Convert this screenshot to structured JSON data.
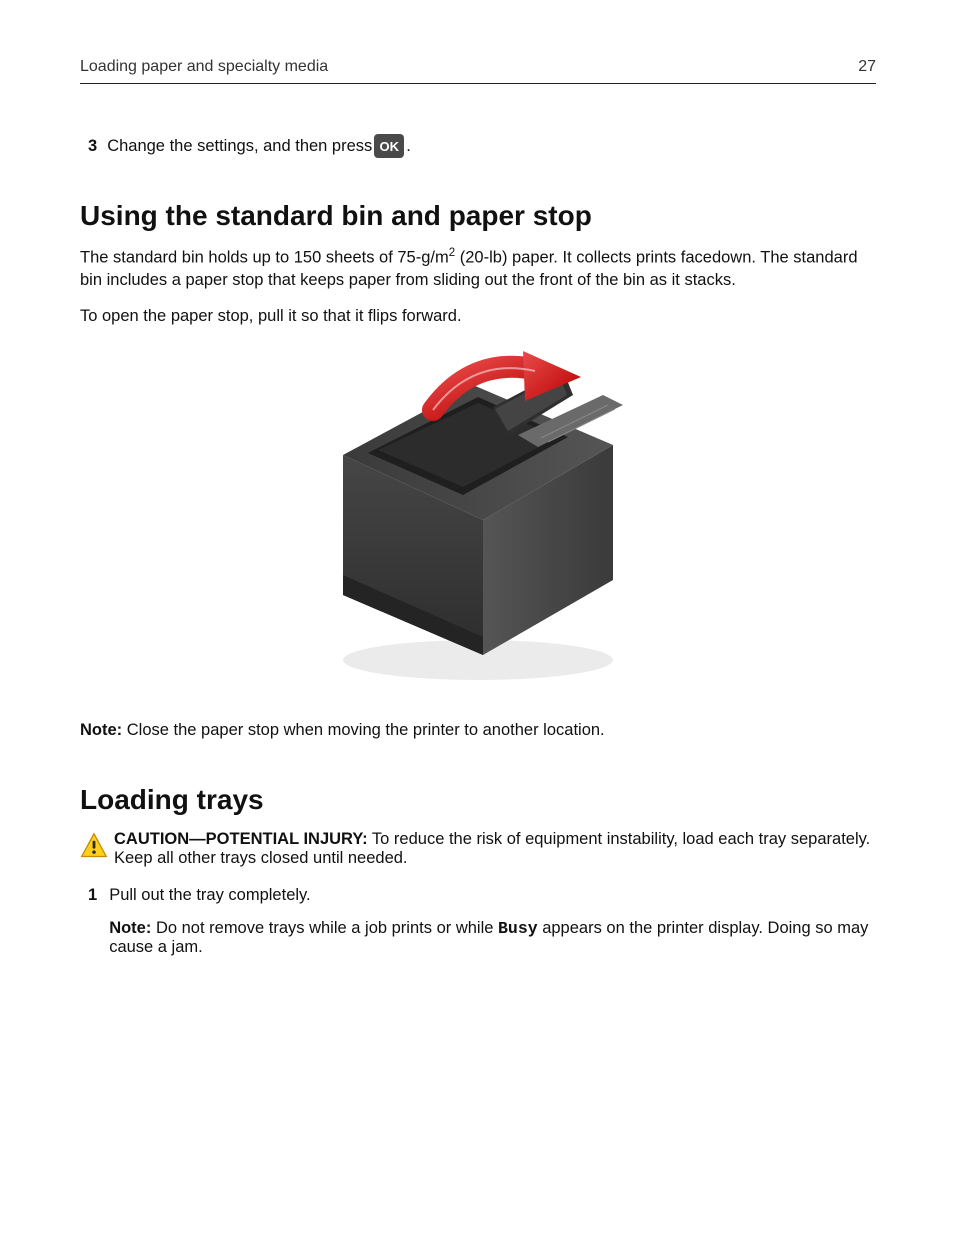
{
  "header": {
    "title": "Loading paper and specialty media",
    "page_no": "27"
  },
  "step3": {
    "num": "3",
    "before": "Change the settings, and then press ",
    "ok": "OK",
    "after": "."
  },
  "section1": {
    "heading": "Using the standard bin and paper stop",
    "p1_a": "The standard bin holds up to 150 sheets of 75‑g/m",
    "p1_sup": "2",
    "p1_b": " (20‑lb) paper. It collects prints facedown. The standard bin includes a paper stop that keeps paper from sliding out the front of the bin as it stacks.",
    "p2": "To open the paper stop, pull it so that it flips forward.",
    "note_label": "Note:",
    "note_text": " Close the paper stop when moving the printer to another location."
  },
  "section2": {
    "heading": "Loading trays",
    "caution_label": "CAUTION—POTENTIAL INJURY:",
    "caution_text": " To reduce the risk of equipment instability, load each tray separately. Keep all other trays closed until needed.",
    "step1_num": "1",
    "step1_text": "Pull out the tray completely.",
    "step1_note_label": "Note:",
    "step1_note_a": " Do not remove trays while a job prints or while ",
    "step1_note_busy": "Busy",
    "step1_note_b": " appears on the printer display. Doing so may cause a jam."
  }
}
